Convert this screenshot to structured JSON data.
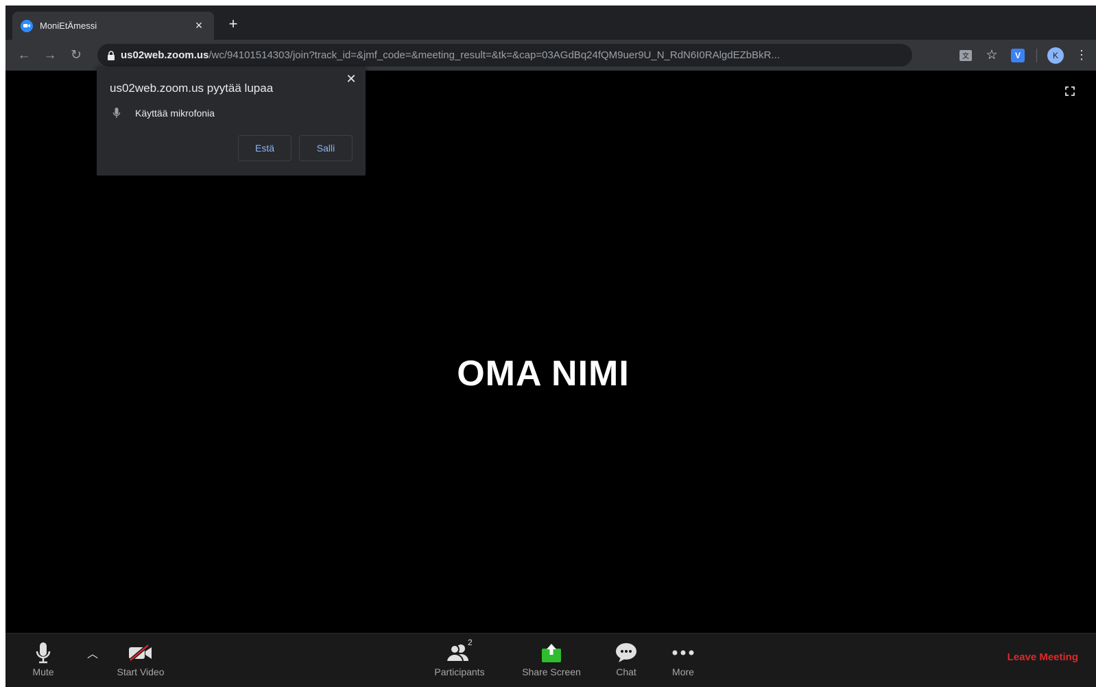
{
  "tab": {
    "title": "MoniEtÄmessi"
  },
  "omnibox": {
    "host": "us02web.zoom.us",
    "path": "/wc/94101514303/join?track_id=&jmf_code=&meeting_result=&tk=&cap=03AGdBq24fQM9uer9U_N_RdN6I0RAlgdEZbBkR..."
  },
  "toolbar": {
    "extension_label": "V",
    "avatar_initial": "K"
  },
  "permission_popup": {
    "title": "us02web.zoom.us pyytää lupaa",
    "permission": "Käyttää mikrofonia",
    "block_label": "Estä",
    "allow_label": "Salli"
  },
  "meeting": {
    "participant_name": "OMA NIMI"
  },
  "zoom_bar": {
    "mute_label": "Mute",
    "video_label": "Start Video",
    "participants_label": "Participants",
    "participants_count": "2",
    "share_label": "Share Screen",
    "chat_label": "Chat",
    "more_label": "More",
    "leave_label": "Leave Meeting"
  },
  "colors": {
    "share_green": "#2ebd2e",
    "leave_red": "#e02828",
    "link_blue": "#8ab4f8",
    "zoom_blue": "#2d8cff"
  }
}
